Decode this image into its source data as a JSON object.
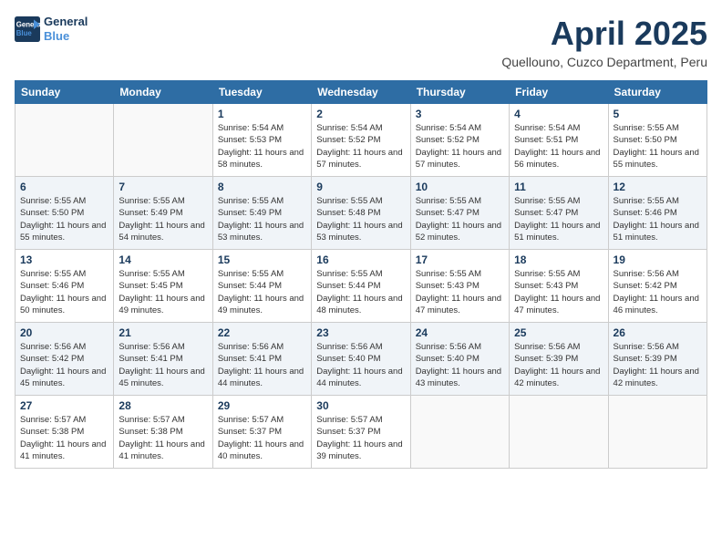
{
  "header": {
    "logo_line1": "General",
    "logo_line2": "Blue",
    "month": "April 2025",
    "location": "Quellouno, Cuzco Department, Peru"
  },
  "weekdays": [
    "Sunday",
    "Monday",
    "Tuesday",
    "Wednesday",
    "Thursday",
    "Friday",
    "Saturday"
  ],
  "weeks": [
    [
      {
        "day": "",
        "info": ""
      },
      {
        "day": "",
        "info": ""
      },
      {
        "day": "1",
        "info": "Sunrise: 5:54 AM\nSunset: 5:53 PM\nDaylight: 11 hours and 58 minutes."
      },
      {
        "day": "2",
        "info": "Sunrise: 5:54 AM\nSunset: 5:52 PM\nDaylight: 11 hours and 57 minutes."
      },
      {
        "day": "3",
        "info": "Sunrise: 5:54 AM\nSunset: 5:52 PM\nDaylight: 11 hours and 57 minutes."
      },
      {
        "day": "4",
        "info": "Sunrise: 5:54 AM\nSunset: 5:51 PM\nDaylight: 11 hours and 56 minutes."
      },
      {
        "day": "5",
        "info": "Sunrise: 5:55 AM\nSunset: 5:50 PM\nDaylight: 11 hours and 55 minutes."
      }
    ],
    [
      {
        "day": "6",
        "info": "Sunrise: 5:55 AM\nSunset: 5:50 PM\nDaylight: 11 hours and 55 minutes."
      },
      {
        "day": "7",
        "info": "Sunrise: 5:55 AM\nSunset: 5:49 PM\nDaylight: 11 hours and 54 minutes."
      },
      {
        "day": "8",
        "info": "Sunrise: 5:55 AM\nSunset: 5:49 PM\nDaylight: 11 hours and 53 minutes."
      },
      {
        "day": "9",
        "info": "Sunrise: 5:55 AM\nSunset: 5:48 PM\nDaylight: 11 hours and 53 minutes."
      },
      {
        "day": "10",
        "info": "Sunrise: 5:55 AM\nSunset: 5:47 PM\nDaylight: 11 hours and 52 minutes."
      },
      {
        "day": "11",
        "info": "Sunrise: 5:55 AM\nSunset: 5:47 PM\nDaylight: 11 hours and 51 minutes."
      },
      {
        "day": "12",
        "info": "Sunrise: 5:55 AM\nSunset: 5:46 PM\nDaylight: 11 hours and 51 minutes."
      }
    ],
    [
      {
        "day": "13",
        "info": "Sunrise: 5:55 AM\nSunset: 5:46 PM\nDaylight: 11 hours and 50 minutes."
      },
      {
        "day": "14",
        "info": "Sunrise: 5:55 AM\nSunset: 5:45 PM\nDaylight: 11 hours and 49 minutes."
      },
      {
        "day": "15",
        "info": "Sunrise: 5:55 AM\nSunset: 5:44 PM\nDaylight: 11 hours and 49 minutes."
      },
      {
        "day": "16",
        "info": "Sunrise: 5:55 AM\nSunset: 5:44 PM\nDaylight: 11 hours and 48 minutes."
      },
      {
        "day": "17",
        "info": "Sunrise: 5:55 AM\nSunset: 5:43 PM\nDaylight: 11 hours and 47 minutes."
      },
      {
        "day": "18",
        "info": "Sunrise: 5:55 AM\nSunset: 5:43 PM\nDaylight: 11 hours and 47 minutes."
      },
      {
        "day": "19",
        "info": "Sunrise: 5:56 AM\nSunset: 5:42 PM\nDaylight: 11 hours and 46 minutes."
      }
    ],
    [
      {
        "day": "20",
        "info": "Sunrise: 5:56 AM\nSunset: 5:42 PM\nDaylight: 11 hours and 45 minutes."
      },
      {
        "day": "21",
        "info": "Sunrise: 5:56 AM\nSunset: 5:41 PM\nDaylight: 11 hours and 45 minutes."
      },
      {
        "day": "22",
        "info": "Sunrise: 5:56 AM\nSunset: 5:41 PM\nDaylight: 11 hours and 44 minutes."
      },
      {
        "day": "23",
        "info": "Sunrise: 5:56 AM\nSunset: 5:40 PM\nDaylight: 11 hours and 44 minutes."
      },
      {
        "day": "24",
        "info": "Sunrise: 5:56 AM\nSunset: 5:40 PM\nDaylight: 11 hours and 43 minutes."
      },
      {
        "day": "25",
        "info": "Sunrise: 5:56 AM\nSunset: 5:39 PM\nDaylight: 11 hours and 42 minutes."
      },
      {
        "day": "26",
        "info": "Sunrise: 5:56 AM\nSunset: 5:39 PM\nDaylight: 11 hours and 42 minutes."
      }
    ],
    [
      {
        "day": "27",
        "info": "Sunrise: 5:57 AM\nSunset: 5:38 PM\nDaylight: 11 hours and 41 minutes."
      },
      {
        "day": "28",
        "info": "Sunrise: 5:57 AM\nSunset: 5:38 PM\nDaylight: 11 hours and 41 minutes."
      },
      {
        "day": "29",
        "info": "Sunrise: 5:57 AM\nSunset: 5:37 PM\nDaylight: 11 hours and 40 minutes."
      },
      {
        "day": "30",
        "info": "Sunrise: 5:57 AM\nSunset: 5:37 PM\nDaylight: 11 hours and 39 minutes."
      },
      {
        "day": "",
        "info": ""
      },
      {
        "day": "",
        "info": ""
      },
      {
        "day": "",
        "info": ""
      }
    ]
  ]
}
